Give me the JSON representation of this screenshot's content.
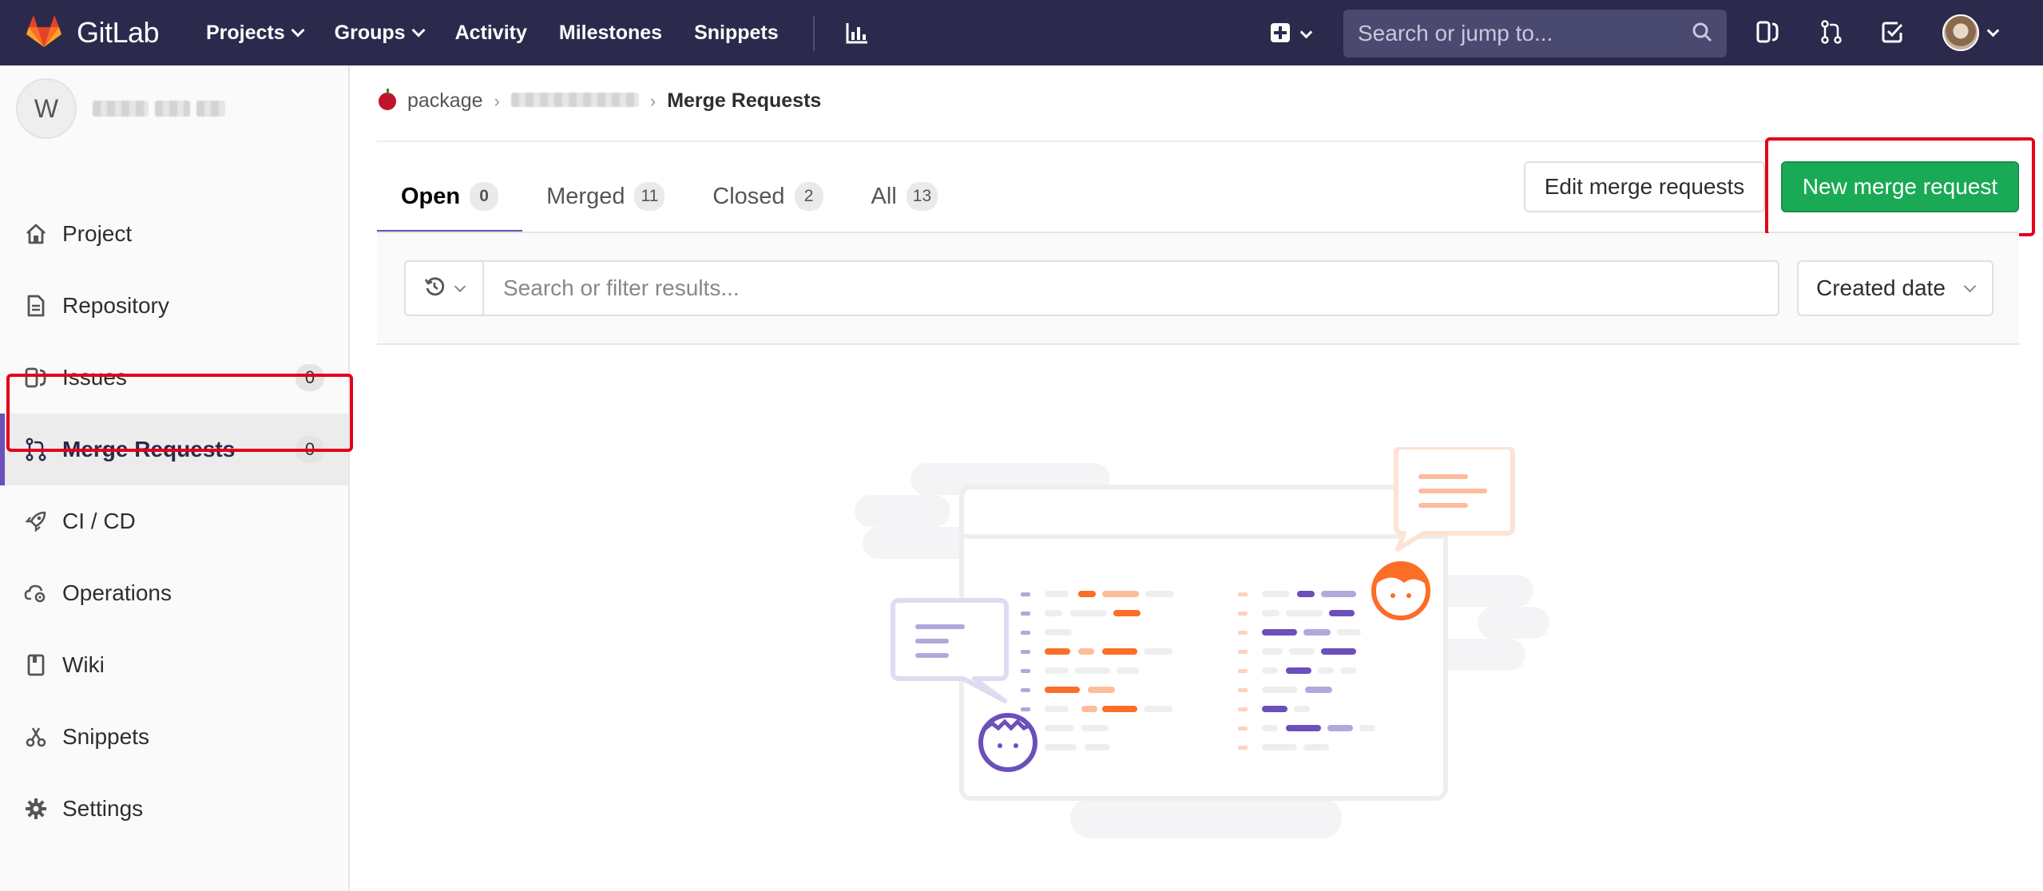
{
  "navbar": {
    "brand": "GitLab",
    "links": [
      {
        "label": "Projects",
        "dropdown": true
      },
      {
        "label": "Groups",
        "dropdown": true
      },
      {
        "label": "Activity",
        "dropdown": false
      },
      {
        "label": "Milestones",
        "dropdown": false
      },
      {
        "label": "Snippets",
        "dropdown": false
      }
    ],
    "search_placeholder": "Search or jump to..."
  },
  "sidebar": {
    "project_initial": "W",
    "items": [
      {
        "label": "Project",
        "icon": "home-icon",
        "count": null
      },
      {
        "label": "Repository",
        "icon": "doc-icon",
        "count": null
      },
      {
        "label": "Issues",
        "icon": "issues-icon",
        "count": "0"
      },
      {
        "label": "Merge Requests",
        "icon": "merge-request-icon",
        "count": "0",
        "active": true
      },
      {
        "label": "CI / CD",
        "icon": "rocket-icon",
        "count": null
      },
      {
        "label": "Operations",
        "icon": "cloud-gear-icon",
        "count": null
      },
      {
        "label": "Wiki",
        "icon": "book-icon",
        "count": null
      },
      {
        "label": "Snippets",
        "icon": "scissors-icon",
        "count": null
      },
      {
        "label": "Settings",
        "icon": "gear-icon",
        "count": null
      }
    ]
  },
  "breadcrumb": {
    "group": "package",
    "current": "Merge Requests"
  },
  "tabs": [
    {
      "label": "Open",
      "count": "0",
      "active": true
    },
    {
      "label": "Merged",
      "count": "11"
    },
    {
      "label": "Closed",
      "count": "2"
    },
    {
      "label": "All",
      "count": "13"
    }
  ],
  "actions": {
    "edit_label": "Edit merge requests",
    "new_label": "New merge request"
  },
  "filter": {
    "placeholder": "Search or filter results...",
    "sort_label": "Created date"
  },
  "colors": {
    "navbar": "#2b2a4c",
    "accent": "#6b4fbb",
    "primary_button": "#1aaa55",
    "highlight": "#e3001b",
    "illus_orange": "#fc6d26",
    "illus_purple": "#6b4fbb"
  }
}
